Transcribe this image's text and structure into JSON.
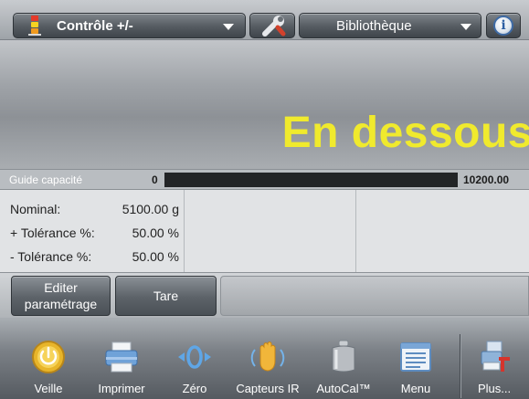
{
  "topbar": {
    "application_label": "Contrôle +/-",
    "library_label": "Bibliothèque",
    "icons": {
      "application": "traffic-light-icon",
      "tools": "wrench-icon",
      "info": "info-icon"
    }
  },
  "display": {
    "result_text": "En dessous",
    "result_color": "#f0ea2d"
  },
  "capacity": {
    "label": "Guide capacité",
    "min": "0",
    "max": "10200.00",
    "fill_fraction": 0
  },
  "reference": {
    "rows": [
      {
        "label": "Nominal:",
        "value": "5100.00 g"
      },
      {
        "label": "+ Tolérance %:",
        "value": "50.00 %"
      },
      {
        "label": "- Tolérance %:",
        "value": "50.00 %"
      }
    ]
  },
  "softkeys": {
    "edit_line1": "Editer",
    "edit_line2": "paramétrage",
    "tare": "Tare"
  },
  "nav": {
    "items": [
      {
        "label": "Veille",
        "icon": "standby-icon"
      },
      {
        "label": "Imprimer",
        "icon": "printer-icon"
      },
      {
        "label": "Zéro",
        "icon": "zero-icon"
      },
      {
        "label": "Capteurs IR",
        "icon": "ir-sensor-icon"
      },
      {
        "label": "AutoCal™",
        "icon": "calibration-weight-icon"
      },
      {
        "label": "Menu",
        "icon": "menu-icon"
      },
      {
        "label": "Plus...",
        "icon": "more-icon"
      }
    ]
  }
}
